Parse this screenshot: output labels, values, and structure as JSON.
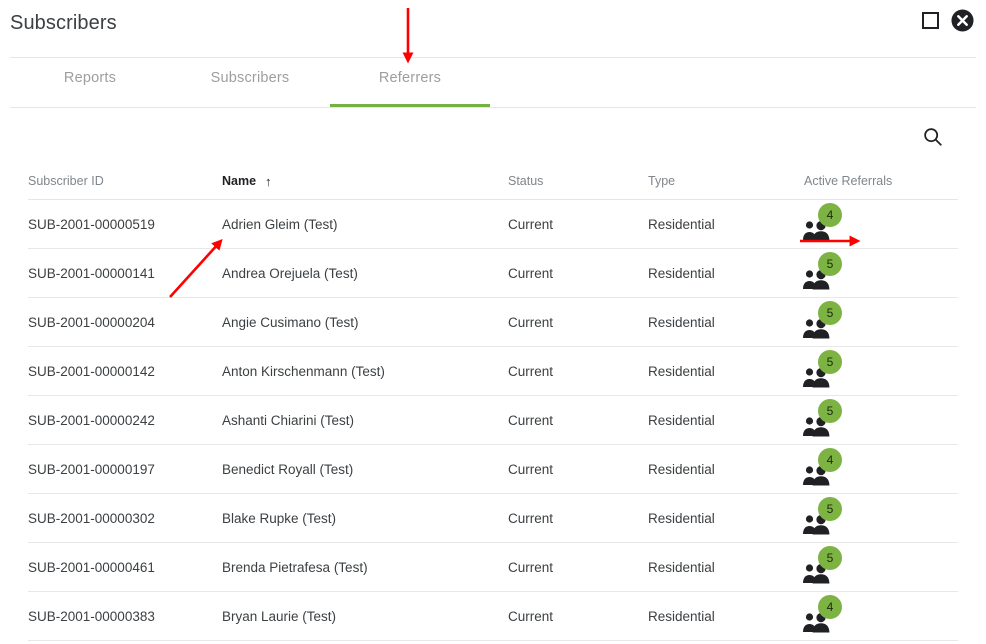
{
  "window": {
    "title": "Subscribers",
    "maximize_label": "Maximize",
    "close_label": "Close"
  },
  "tabs": [
    {
      "label": "Reports",
      "active": false
    },
    {
      "label": "Subscribers",
      "active": false
    },
    {
      "label": "Referrers",
      "active": true
    }
  ],
  "toolbar": {
    "search_label": "Search"
  },
  "table": {
    "columns": [
      {
        "key": "id",
        "label": "Subscriber ID",
        "sorted": false
      },
      {
        "key": "name",
        "label": "Name",
        "sorted": true,
        "sort_direction": "ascending",
        "sort_glyph": "↑"
      },
      {
        "key": "status",
        "label": "Status",
        "sorted": false
      },
      {
        "key": "type",
        "label": "Type",
        "sorted": false
      },
      {
        "key": "referrals",
        "label": "Active Referrals",
        "sorted": false
      }
    ],
    "rows": [
      {
        "id": "SUB-2001-00000519",
        "name": "Adrien Gleim (Test)",
        "status": "Current",
        "type": "Residential",
        "referrals": "4"
      },
      {
        "id": "SUB-2001-00000141",
        "name": "Andrea Orejuela (Test)",
        "status": "Current",
        "type": "Residential",
        "referrals": "5"
      },
      {
        "id": "SUB-2001-00000204",
        "name": "Angie Cusimano (Test)",
        "status": "Current",
        "type": "Residential",
        "referrals": "5"
      },
      {
        "id": "SUB-2001-00000142",
        "name": "Anton Kirschenmann (Test)",
        "status": "Current",
        "type": "Residential",
        "referrals": "5"
      },
      {
        "id": "SUB-2001-00000242",
        "name": "Ashanti Chiarini (Test)",
        "status": "Current",
        "type": "Residential",
        "referrals": "5"
      },
      {
        "id": "SUB-2001-00000197",
        "name": "Benedict Royall (Test)",
        "status": "Current",
        "type": "Residential",
        "referrals": "4"
      },
      {
        "id": "SUB-2001-00000302",
        "name": "Blake Rupke (Test)",
        "status": "Current",
        "type": "Residential",
        "referrals": "5"
      },
      {
        "id": "SUB-2001-00000461",
        "name": "Brenda Pietrafesa (Test)",
        "status": "Current",
        "type": "Residential",
        "referrals": "5"
      },
      {
        "id": "SUB-2001-00000383",
        "name": "Bryan Laurie (Test)",
        "status": "Current",
        "type": "Residential",
        "referrals": "4"
      }
    ]
  },
  "colors": {
    "accent_green": "#76b043",
    "badge_green": "#7cb342",
    "annotation_red": "#ff0000",
    "tab_inactive": "#9e9e9e",
    "text_primary": "#3c4043",
    "header_text": "#80868b"
  },
  "annotations": [
    {
      "name": "arrow-to-referrers-tab",
      "direction": "down"
    },
    {
      "name": "arrow-to-subscriber-id",
      "direction": "up-right"
    },
    {
      "name": "arrow-to-active-referrals-icon",
      "direction": "right"
    }
  ]
}
